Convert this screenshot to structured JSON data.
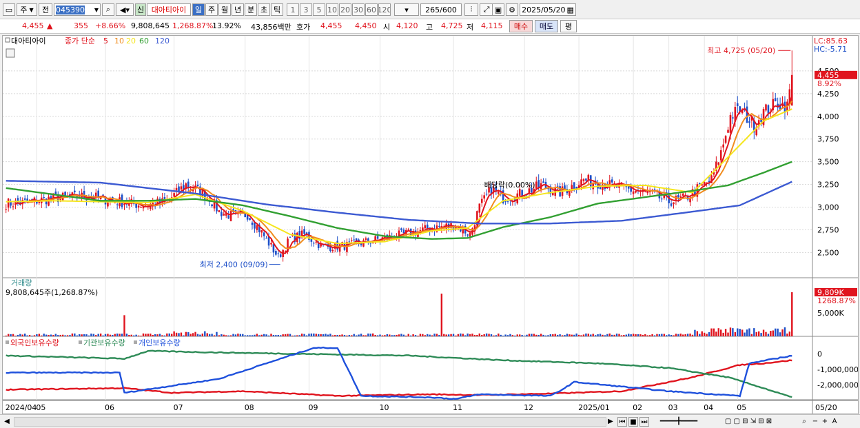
{
  "toolbar": {
    "market": "주",
    "exchange": "전",
    "stock_code": "045390",
    "badge_new": "신",
    "stock_name": "대아티아이",
    "periods": [
      "일",
      "주",
      "월",
      "년",
      "분",
      "초",
      "틱"
    ],
    "active_period": "일",
    "intervals": [
      "1",
      "3",
      "5",
      "10",
      "20",
      "30",
      "60",
      "120"
    ],
    "count_display": "265",
    "count_total": "/600",
    "date": "2025/05/20"
  },
  "quote": {
    "price": "4,455",
    "change_arrow": "▲",
    "change": "355",
    "change_pct": "+8.66%",
    "volume": "9,808,645",
    "volume_ratio": "1,268.87%",
    "turnover": "13.92%",
    "amount": "43,856백만",
    "ask_label": "호가",
    "ask": "4,455",
    "bid": "4,450",
    "open_label": "시",
    "open": "4,120",
    "high_label": "고",
    "high": "4,725",
    "low_label": "저",
    "low": "4,115",
    "buy_label": "매수",
    "sell_label": "매도",
    "eval_label": "평"
  },
  "price_panel": {
    "legend_name": "대아티아이",
    "legend_ma_label": "종가 단순",
    "ma_periods": [
      "5",
      "10",
      "20",
      "60",
      "120"
    ],
    "lc": "LC:85.63",
    "hc": "HC:-5.71",
    "high_note": "최고 4,725 (05/20)",
    "low_note": "최저 2,400 (09/09)",
    "ex_note": "배당락(0.00%)",
    "last_price_tag": "4,455",
    "last_pct": "8.92%"
  },
  "volume_panel": {
    "title": "거래량",
    "summary": "9,808,645주(1,268.87%)",
    "last_tag": "9,809K",
    "last_pct": "1268.87%",
    "axis_label": "5,000K"
  },
  "holder_panel": {
    "legend": [
      "외국인보유수량",
      "기관보유수량",
      "개인보유수량"
    ],
    "axis_labels": [
      "0",
      "-1,000,000",
      "-2,000,000"
    ]
  },
  "colors": {
    "up": "#e0141e",
    "down": "#1e50c8",
    "ma5": "#e0141e",
    "ma10": "#f08c1e",
    "ma20": "#f5e61e",
    "ma60": "#32a032",
    "ma120": "#3c5ad2",
    "foreign": "#e0141e",
    "institution": "#2e8b57",
    "individual": "#1e50dc"
  },
  "chart_data": {
    "type": "candlestick",
    "x_axis_labels": [
      "2024/04",
      "05",
      "06",
      "07",
      "08",
      "09",
      "10",
      "11",
      "12",
      "2025/01",
      "02",
      "03",
      "04",
      "05",
      "05/20"
    ],
    "price_axis_ticks": [
      2500,
      2750,
      3000,
      3250,
      3500,
      3750,
      4000,
      4250,
      4500
    ],
    "ylim": [
      2230,
      4780
    ],
    "high": {
      "value": 4725,
      "date": "05/20"
    },
    "low": {
      "value": 2400,
      "date": "09/09"
    },
    "last": {
      "open": 4120,
      "high": 4725,
      "low": 4115,
      "close": 4455
    },
    "series_anchors": {
      "close": [
        [
          0,
          3040
        ],
        [
          8,
          3050
        ],
        [
          20,
          3100
        ],
        [
          35,
          3120
        ],
        [
          45,
          3070
        ],
        [
          58,
          3020
        ],
        [
          68,
          3060
        ],
        [
          76,
          3250
        ],
        [
          80,
          3200
        ],
        [
          86,
          3100
        ],
        [
          90,
          2950
        ],
        [
          96,
          2900
        ],
        [
          102,
          2920
        ],
        [
          108,
          2720
        ],
        [
          115,
          2450
        ],
        [
          120,
          2650
        ],
        [
          126,
          2700
        ],
        [
          134,
          2560
        ],
        [
          145,
          2580
        ],
        [
          158,
          2650
        ],
        [
          168,
          2700
        ],
        [
          175,
          2740
        ],
        [
          182,
          2780
        ],
        [
          190,
          2800
        ],
        [
          196,
          2700
        ],
        [
          200,
          3000
        ],
        [
          205,
          3200
        ],
        [
          210,
          3100
        ],
        [
          218,
          3150
        ],
        [
          226,
          3240
        ],
        [
          234,
          3160
        ],
        [
          244,
          3300
        ],
        [
          252,
          3260
        ],
        [
          262,
          3200
        ],
        [
          272,
          3150
        ],
        [
          280,
          3060
        ],
        [
          287,
          3100
        ],
        [
          292,
          3200
        ],
        [
          298,
          3300
        ],
        [
          302,
          3600
        ],
        [
          306,
          4000
        ],
        [
          310,
          4080
        ],
        [
          316,
          3900
        ],
        [
          320,
          4050
        ],
        [
          326,
          4150
        ],
        [
          330,
          4110
        ],
        [
          332,
          4455
        ]
      ],
      "ma20": [
        [
          0,
          3060
        ],
        [
          20,
          3070
        ],
        [
          40,
          3060
        ],
        [
          60,
          3050
        ],
        [
          80,
          3140
        ],
        [
          100,
          2960
        ],
        [
          120,
          2700
        ],
        [
          140,
          2600
        ],
        [
          160,
          2620
        ],
        [
          180,
          2740
        ],
        [
          195,
          2770
        ],
        [
          210,
          3070
        ],
        [
          230,
          3160
        ],
        [
          250,
          3230
        ],
        [
          270,
          3240
        ],
        [
          290,
          3160
        ],
        [
          305,
          3550
        ],
        [
          320,
          3950
        ],
        [
          332,
          4080
        ]
      ],
      "ma60": [
        [
          0,
          3210
        ],
        [
          20,
          3140
        ],
        [
          40,
          3070
        ],
        [
          60,
          3070
        ],
        [
          80,
          3090
        ],
        [
          100,
          3020
        ],
        [
          120,
          2900
        ],
        [
          140,
          2770
        ],
        [
          160,
          2680
        ],
        [
          180,
          2650
        ],
        [
          195,
          2660
        ],
        [
          210,
          2780
        ],
        [
          230,
          2890
        ],
        [
          250,
          3040
        ],
        [
          270,
          3110
        ],
        [
          290,
          3180
        ],
        [
          305,
          3240
        ],
        [
          320,
          3380
        ],
        [
          332,
          3500
        ]
      ],
      "ma120": [
        [
          0,
          3290
        ],
        [
          40,
          3270
        ],
        [
          80,
          3150
        ],
        [
          110,
          3030
        ],
        [
          140,
          2940
        ],
        [
          170,
          2860
        ],
        [
          200,
          2820
        ],
        [
          230,
          2820
        ],
        [
          260,
          2850
        ],
        [
          290,
          2950
        ],
        [
          310,
          3020
        ],
        [
          332,
          3280
        ]
      ]
    },
    "volume_ylim": [
      0,
      9808645
    ],
    "volume_spikes": [
      [
        50,
        4700000
      ],
      [
        184,
        9500000
      ],
      [
        332,
        9808645
      ]
    ],
    "holders": {
      "foreign": [
        [
          0,
          -2300000
        ],
        [
          50,
          -2200000
        ],
        [
          70,
          -2500000
        ],
        [
          100,
          -2400000
        ],
        [
          140,
          -2700000
        ],
        [
          180,
          -2600000
        ],
        [
          200,
          -2650000
        ],
        [
          230,
          -2550000
        ],
        [
          260,
          -2400000
        ],
        [
          290,
          -1500000
        ],
        [
          310,
          -700000
        ],
        [
          320,
          -600000
        ],
        [
          332,
          -400000
        ]
      ],
      "institution": [
        [
          0,
          -100000
        ],
        [
          50,
          -300000
        ],
        [
          60,
          200000
        ],
        [
          90,
          100000
        ],
        [
          130,
          0
        ],
        [
          170,
          -100000
        ],
        [
          210,
          -400000
        ],
        [
          250,
          -600000
        ],
        [
          280,
          -900000
        ],
        [
          305,
          -1500000
        ],
        [
          320,
          -2200000
        ],
        [
          332,
          -2800000
        ]
      ],
      "individual": [
        [
          0,
          -1200000
        ],
        [
          48,
          -1200000
        ],
        [
          50,
          -2500000
        ],
        [
          90,
          -1600000
        ],
        [
          130,
          400000
        ],
        [
          140,
          400000
        ],
        [
          150,
          -2700000
        ],
        [
          180,
          -2800000
        ],
        [
          190,
          -2900000
        ],
        [
          200,
          -2600000
        ],
        [
          230,
          -2700000
        ],
        [
          236,
          -2200000
        ],
        [
          240,
          -1800000
        ],
        [
          280,
          -2400000
        ],
        [
          310,
          -2700000
        ],
        [
          314,
          -600000
        ],
        [
          332,
          -100000
        ]
      ]
    }
  }
}
